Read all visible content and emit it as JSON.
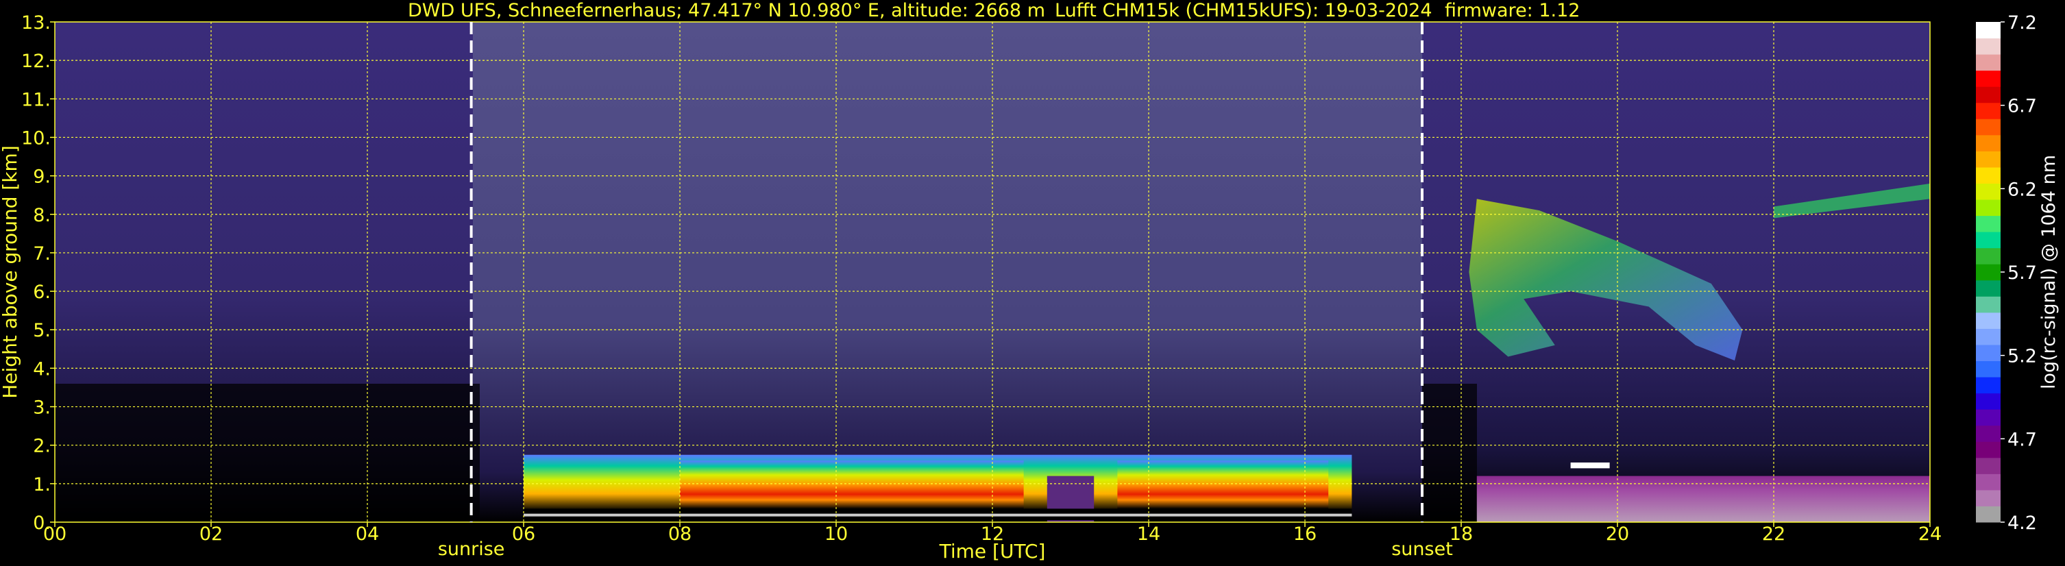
{
  "chart_data": {
    "type": "heatmap",
    "title_left": "DWD UFS, Schneefernerhaus; 47.417° N 10.980° E, altitude: 2668 m",
    "title_mid": "Lufft CHM15k (CHM15kUFS): 19-03-2024",
    "title_right": "firmware: 1.12",
    "xlabel": "Time [UTC]",
    "ylabel": "Height above ground [km]",
    "colorbar_label": "log(rc-signal) @ 1064 nm",
    "xlim": [
      0,
      24
    ],
    "ylim": [
      0,
      13
    ],
    "x_ticks": [
      "00",
      "02",
      "04",
      "06",
      "08",
      "10",
      "12",
      "14",
      "16",
      "18",
      "20",
      "22",
      "24"
    ],
    "y_ticks": [
      "0.",
      "1.",
      "2.",
      "3.",
      "4.",
      "5.",
      "6.",
      "7.",
      "8.",
      "9.",
      "10.",
      "11.",
      "12.",
      "13."
    ],
    "colorbar_ticks": [
      "4.2",
      "4.7",
      "5.2",
      "5.7",
      "6.2",
      "6.7",
      "7.2"
    ],
    "colorbar_range": [
      4.2,
      7.2
    ],
    "grid": true,
    "annotations": [
      {
        "label": "sunrise",
        "time": 5.33
      },
      {
        "label": "sunset",
        "time": 17.5
      }
    ],
    "features": [
      {
        "kind": "boundary-layer aerosol",
        "start": 6.0,
        "end": 16.6,
        "base_km": 0.3,
        "top_km": 1.75
      },
      {
        "kind": "cloud layer",
        "start": 18.2,
        "end": 24.0,
        "base_km": 0.0,
        "top_km": 1.2
      },
      {
        "kind": "cirrus",
        "start": 18.1,
        "end": 24.0,
        "base_km": 4.2,
        "top_km": 8.8
      }
    ]
  }
}
